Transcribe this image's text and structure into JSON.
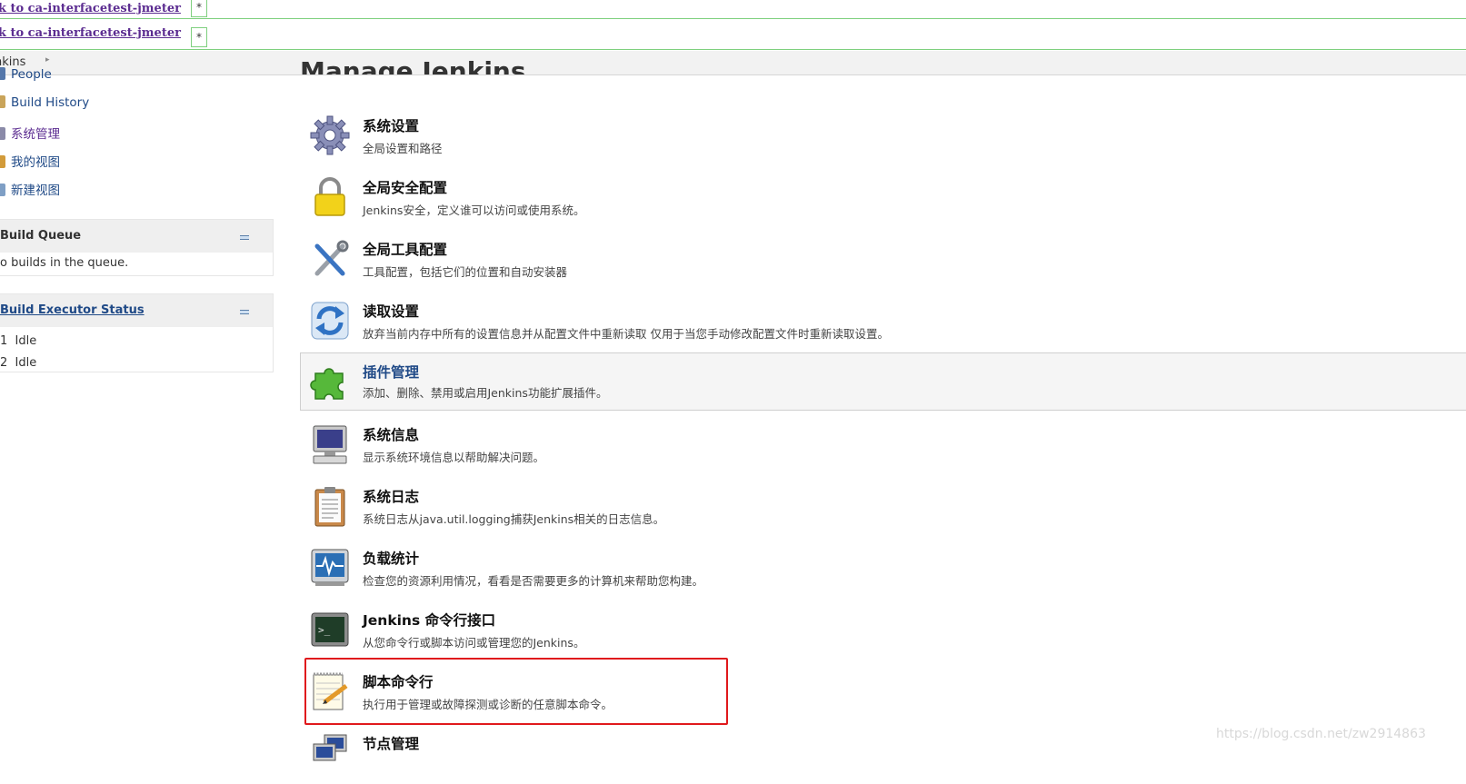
{
  "top_links": [
    {
      "label": "ck to ca-interfacetest-jmeter",
      "marker": "*"
    },
    {
      "label": "ck to ca-interfacetest-jmeter",
      "marker": "*"
    }
  ],
  "breadcrumb": {
    "root": "nkins",
    "arrow": "▸"
  },
  "sidebar": {
    "items": [
      {
        "label": "People"
      },
      {
        "label": "Build History"
      },
      {
        "label": "系统管理"
      },
      {
        "label": "我的视图"
      },
      {
        "label": "新建视图"
      }
    ]
  },
  "build_queue": {
    "title": "Build Queue",
    "empty_text": "o builds in the queue."
  },
  "executors": {
    "title": "Build Executor Status",
    "rows": [
      {
        "num": "1",
        "status": "Idle"
      },
      {
        "num": "2",
        "status": "Idle"
      }
    ]
  },
  "page": {
    "title": "Manage Jenkins"
  },
  "entries": [
    {
      "name": "系统设置",
      "desc": "全局设置和路径"
    },
    {
      "name": "全局安全配置",
      "desc": "Jenkins安全，定义谁可以访问或使用系统。"
    },
    {
      "name": "全局工具配置",
      "desc": "工具配置，包括它们的位置和自动安装器"
    },
    {
      "name": "读取设置",
      "desc": "放弃当前内存中所有的设置信息并从配置文件中重新读取 仅用于当您手动修改配置文件时重新读取设置。"
    },
    {
      "name": "插件管理",
      "desc": "添加、删除、禁用或启用Jenkins功能扩展插件。"
    },
    {
      "name": "系统信息",
      "desc": "显示系统环境信息以帮助解决问题。"
    },
    {
      "name": "系统日志",
      "desc": "系统日志从java.util.logging捕获Jenkins相关的日志信息。"
    },
    {
      "name": "负载统计",
      "desc": "检查您的资源利用情况，看看是否需要更多的计算机来帮助您构建。"
    },
    {
      "name": "Jenkins 命令行接口",
      "desc": "从您命令行或脚本访问或管理您的Jenkins。"
    },
    {
      "name": "脚本命令行",
      "desc": "执行用于管理或故障探测或诊断的任意脚本命令。"
    },
    {
      "name": "节点管理",
      "desc": ""
    }
  ],
  "watermark": "https://blog.csdn.net/zw2914863",
  "colors": {
    "accent_red": "#e0191c",
    "link": "#204a87",
    "visited": "#5c2d91",
    "green_border": "#7ed07e"
  }
}
